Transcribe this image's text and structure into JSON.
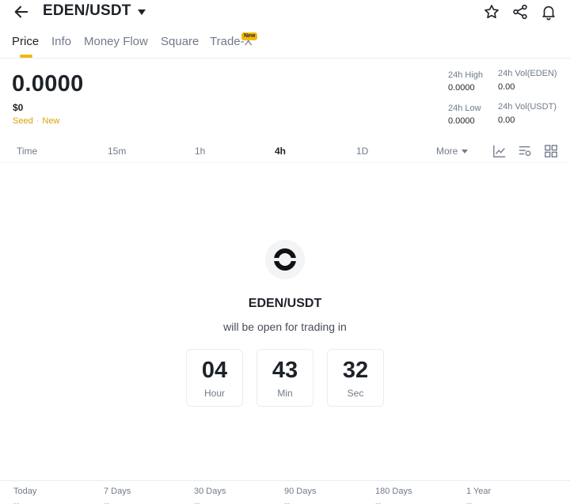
{
  "header": {
    "pair": "EDEN/USDT",
    "icons": [
      "back-arrow-icon",
      "star-icon",
      "share-icon",
      "bell-icon"
    ]
  },
  "tabs": [
    {
      "label": "Price",
      "active": true
    },
    {
      "label": "Info",
      "active": false
    },
    {
      "label": "Money Flow",
      "active": false
    },
    {
      "label": "Square",
      "active": false
    },
    {
      "label": "Trade-X",
      "active": false,
      "badge": "New"
    }
  ],
  "price": {
    "last": "0.0000",
    "usd": "$0",
    "tags": [
      "Seed",
      "New"
    ]
  },
  "stats": {
    "high_label": "24h High",
    "high_value": "0.0000",
    "low_label": "24h Low",
    "low_value": "0.0000",
    "vol_base_label": "24h Vol(EDEN)",
    "vol_base_value": "0.00",
    "vol_quote_label": "24h Vol(USDT)",
    "vol_quote_value": "0.00"
  },
  "timeframes": {
    "items": [
      "Time",
      "15m",
      "1h",
      "4h",
      "1D"
    ],
    "active": "4h",
    "more_label": "More",
    "tool_icons": [
      "line-chart-icon",
      "indicator-settings-icon",
      "grid-layout-icon"
    ]
  },
  "launch": {
    "title": "EDEN/USDT",
    "subtitle": "will be open for trading in",
    "countdown": [
      {
        "value": "04",
        "unit": "Hour"
      },
      {
        "value": "43",
        "unit": "Min"
      },
      {
        "value": "32",
        "unit": "Sec"
      }
    ]
  },
  "performance": [
    {
      "label": "Today",
      "value": "--"
    },
    {
      "label": "7 Days",
      "value": "--"
    },
    {
      "label": "30 Days",
      "value": "--"
    },
    {
      "label": "90 Days",
      "value": "--"
    },
    {
      "label": "180 Days",
      "value": "--"
    },
    {
      "label": "1 Year",
      "value": "--"
    }
  ],
  "colors": {
    "accent": "#f0b90b",
    "tag": "#d8a206",
    "text": "#1e2329",
    "muted": "#707a8a"
  }
}
